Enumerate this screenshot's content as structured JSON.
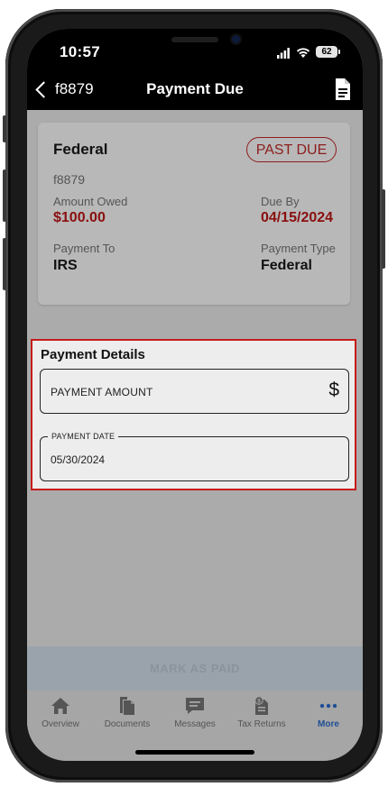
{
  "status": {
    "time": "10:57",
    "battery": "62"
  },
  "nav": {
    "back_label": "f8879",
    "title": "Payment Due"
  },
  "card": {
    "title": "Federal",
    "badge": "PAST DUE",
    "form_id": "f8879",
    "amount_owed_label": "Amount Owed",
    "amount_owed": "$100.00",
    "due_by_label": "Due By",
    "due_by": "04/15/2024",
    "payment_to_label": "Payment To",
    "payment_to": "IRS",
    "payment_type_label": "Payment Type",
    "payment_type": "Federal"
  },
  "details": {
    "title": "Payment Details",
    "amount_placeholder": "PAYMENT AMOUNT",
    "currency_symbol": "$",
    "date_label": "PAYMENT DATE",
    "date_value": "05/30/2024"
  },
  "mark_paid_label": "MARK AS PAID",
  "tabs": [
    {
      "label": "Overview",
      "icon": "home-icon"
    },
    {
      "label": "Documents",
      "icon": "documents-icon"
    },
    {
      "label": "Messages",
      "icon": "messages-icon"
    },
    {
      "label": "Tax Returns",
      "icon": "tax-returns-icon"
    },
    {
      "label": "More",
      "icon": "more-icon",
      "active": true
    }
  ],
  "colors": {
    "accent_red": "#8a0f0f",
    "highlight_border": "#c71b1b",
    "active_tab": "#1e4e95"
  }
}
